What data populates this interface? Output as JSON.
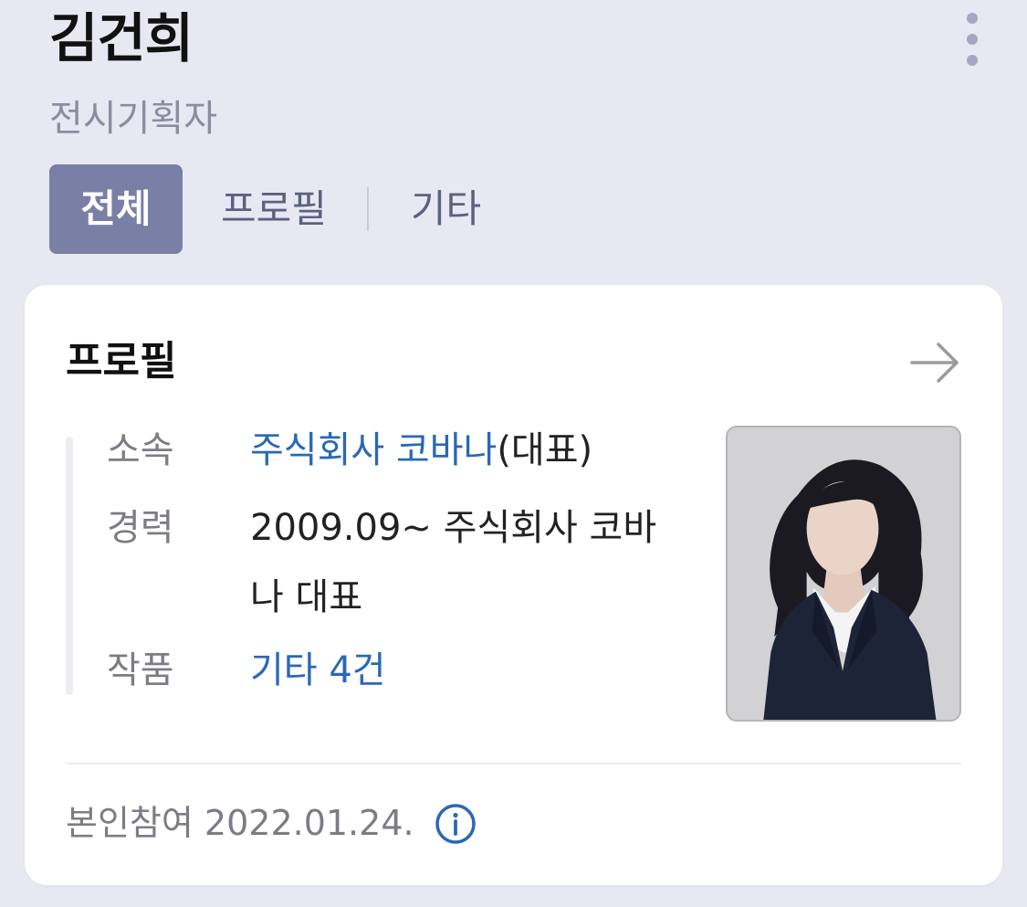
{
  "header": {
    "name": "김건희",
    "subtitle": "전시기획자"
  },
  "tabs": [
    {
      "label": "전체",
      "active": true
    },
    {
      "label": "프로필",
      "active": false
    },
    {
      "label": "기타",
      "active": false
    }
  ],
  "profile_card": {
    "title": "프로필",
    "rows": [
      {
        "label": "소속",
        "link": "주식회사 코바나",
        "suffix": "(대표)"
      },
      {
        "label": "경력",
        "value": "2009.09~ 주식회사 코바나 대표"
      },
      {
        "label": "작품",
        "link": "기타 4건"
      }
    ],
    "footer": "본인참여 2022.01.24."
  },
  "icons": {
    "more": "more-vertical-icon",
    "arrow": "arrow-right-icon",
    "info": "info-circle-icon"
  },
  "colors": {
    "background": "#e8e8f2",
    "active_tab": "#7a7fa6",
    "link": "#2a68b5",
    "muted_text": "#7c7c86"
  }
}
